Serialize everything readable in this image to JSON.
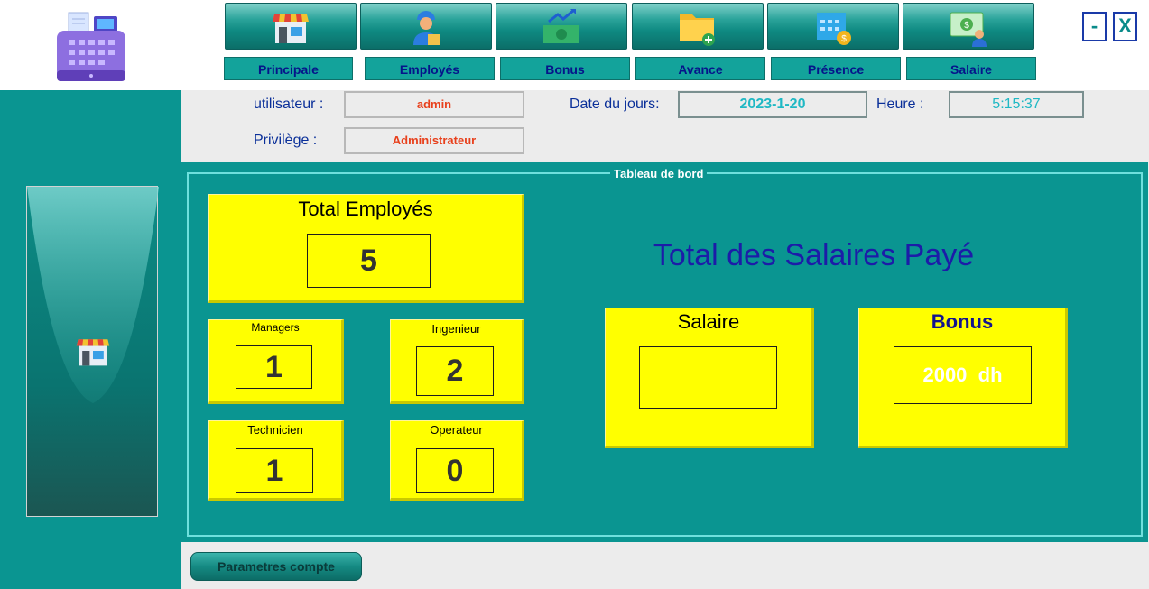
{
  "nav": {
    "items": [
      {
        "label": "Principale",
        "icon": "store-icon"
      },
      {
        "label": "Employés",
        "icon": "worker-icon"
      },
      {
        "label": "Bonus",
        "icon": "money-growth-icon"
      },
      {
        "label": "Avance",
        "icon": "folder-add-icon"
      },
      {
        "label": "Présence",
        "icon": "calendar-money-icon"
      },
      {
        "label": "Salaire",
        "icon": "salary-icon"
      }
    ]
  },
  "window": {
    "minimize_label": "-",
    "close_label": "X"
  },
  "session": {
    "user_label": "utilisateur :",
    "user_value": "admin",
    "privilege_label": "Privilège :",
    "privilege_value": "Administrateur",
    "date_label": "Date du jours:",
    "date_value": "2023-1-20",
    "time_label": "Heure :",
    "time_value": "5:15:37"
  },
  "dashboard": {
    "title": "Tableau de bord",
    "total_employes_label": "Total Employés",
    "total_employes_value": "5",
    "managers_label": "Managers",
    "managers_value": "1",
    "ingenieur_label": "Ingenieur",
    "ingenieur_value": "2",
    "technicien_label": "Technicien",
    "technicien_value": "1",
    "operateur_label": "Operateur",
    "operateur_value": "0",
    "total_salaires_label": "Total des Salaires Payé",
    "salaire_label": "Salaire",
    "salaire_value": "",
    "bonus_label": "Bonus",
    "bonus_value": "2000  dh"
  },
  "footer": {
    "params_button": "Parametres compte"
  },
  "colors": {
    "teal": "#0a9591",
    "yellow": "#ffff00",
    "navy": "#0a2f99",
    "red": "#e8401c"
  }
}
